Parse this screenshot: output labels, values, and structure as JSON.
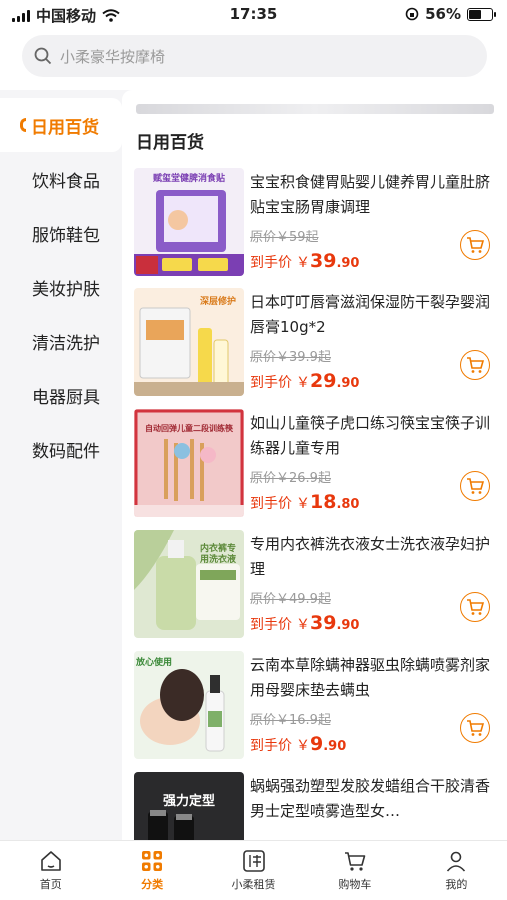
{
  "status_bar": {
    "carrier": "中国移动",
    "time": "17:35",
    "battery_percent": "56%",
    "battery_level": 0.56
  },
  "search": {
    "placeholder": "小柔豪华按摩椅",
    "icon": "search-icon"
  },
  "sidebar": {
    "items": [
      {
        "label": "日用百货",
        "active": true
      },
      {
        "label": "饮料食品"
      },
      {
        "label": "服饰鞋包"
      },
      {
        "label": "美妆护肤"
      },
      {
        "label": "清洁洗护"
      },
      {
        "label": "电器厨具"
      },
      {
        "label": "数码配件"
      }
    ]
  },
  "section_title": "日用百货",
  "products": [
    {
      "name": "宝宝积食健胃贴婴儿健养胃儿童肚脐贴宝宝肠胃康调理",
      "original_price": "原价￥59起",
      "price_label": "到手价",
      "price_symbol": "￥",
      "price_int": "39",
      "price_dec": ".90",
      "image_text": "赋玺堂健脾消食贴"
    },
    {
      "name": "日本叮叮唇膏滋润保湿防干裂孕婴润唇膏10g*2",
      "original_price": "原价￥39.9起",
      "price_label": "到手价",
      "price_symbol": "￥",
      "price_int": "29",
      "price_dec": ".90",
      "image_text": "深层修护"
    },
    {
      "name": "如山儿童筷子虎口练习筷宝宝筷子训练器儿童专用",
      "original_price": "原价￥26.9起",
      "price_label": "到手价",
      "price_symbol": "￥",
      "price_int": "18",
      "price_dec": ".80",
      "image_text": "自动回弹儿童二段训练筷"
    },
    {
      "name": "专用内衣裤洗衣液女士洗衣液孕妇护理",
      "original_price": "原价￥49.9起",
      "price_label": "到手价",
      "price_symbol": "￥",
      "price_int": "39",
      "price_dec": ".90",
      "image_text": "内衣裤专用洗衣液"
    },
    {
      "name": "云南本草除螨神器驱虫除螨喷雾剂家用母婴床垫去螨虫",
      "original_price": "原价￥16.9起",
      "price_label": "到手价",
      "price_symbol": "￥",
      "price_int": "9",
      "price_dec": ".90",
      "image_text": "放心使用"
    },
    {
      "name": "蜗蜗强劲塑型发胶发蜡组合干胶清香男士定型喷雾造型女…",
      "image_text": "强力定型"
    }
  ],
  "tabbar": {
    "items": [
      {
        "label": "首页",
        "icon": "home-icon"
      },
      {
        "label": "分类",
        "icon": "category-icon",
        "active": true
      },
      {
        "label": "小柔租赁",
        "icon": "rent-icon"
      },
      {
        "label": "购物车",
        "icon": "cart-icon"
      },
      {
        "label": "我的",
        "icon": "profile-icon"
      }
    ]
  },
  "colors": {
    "accent": "#f07b00",
    "price": "#e8380d"
  }
}
